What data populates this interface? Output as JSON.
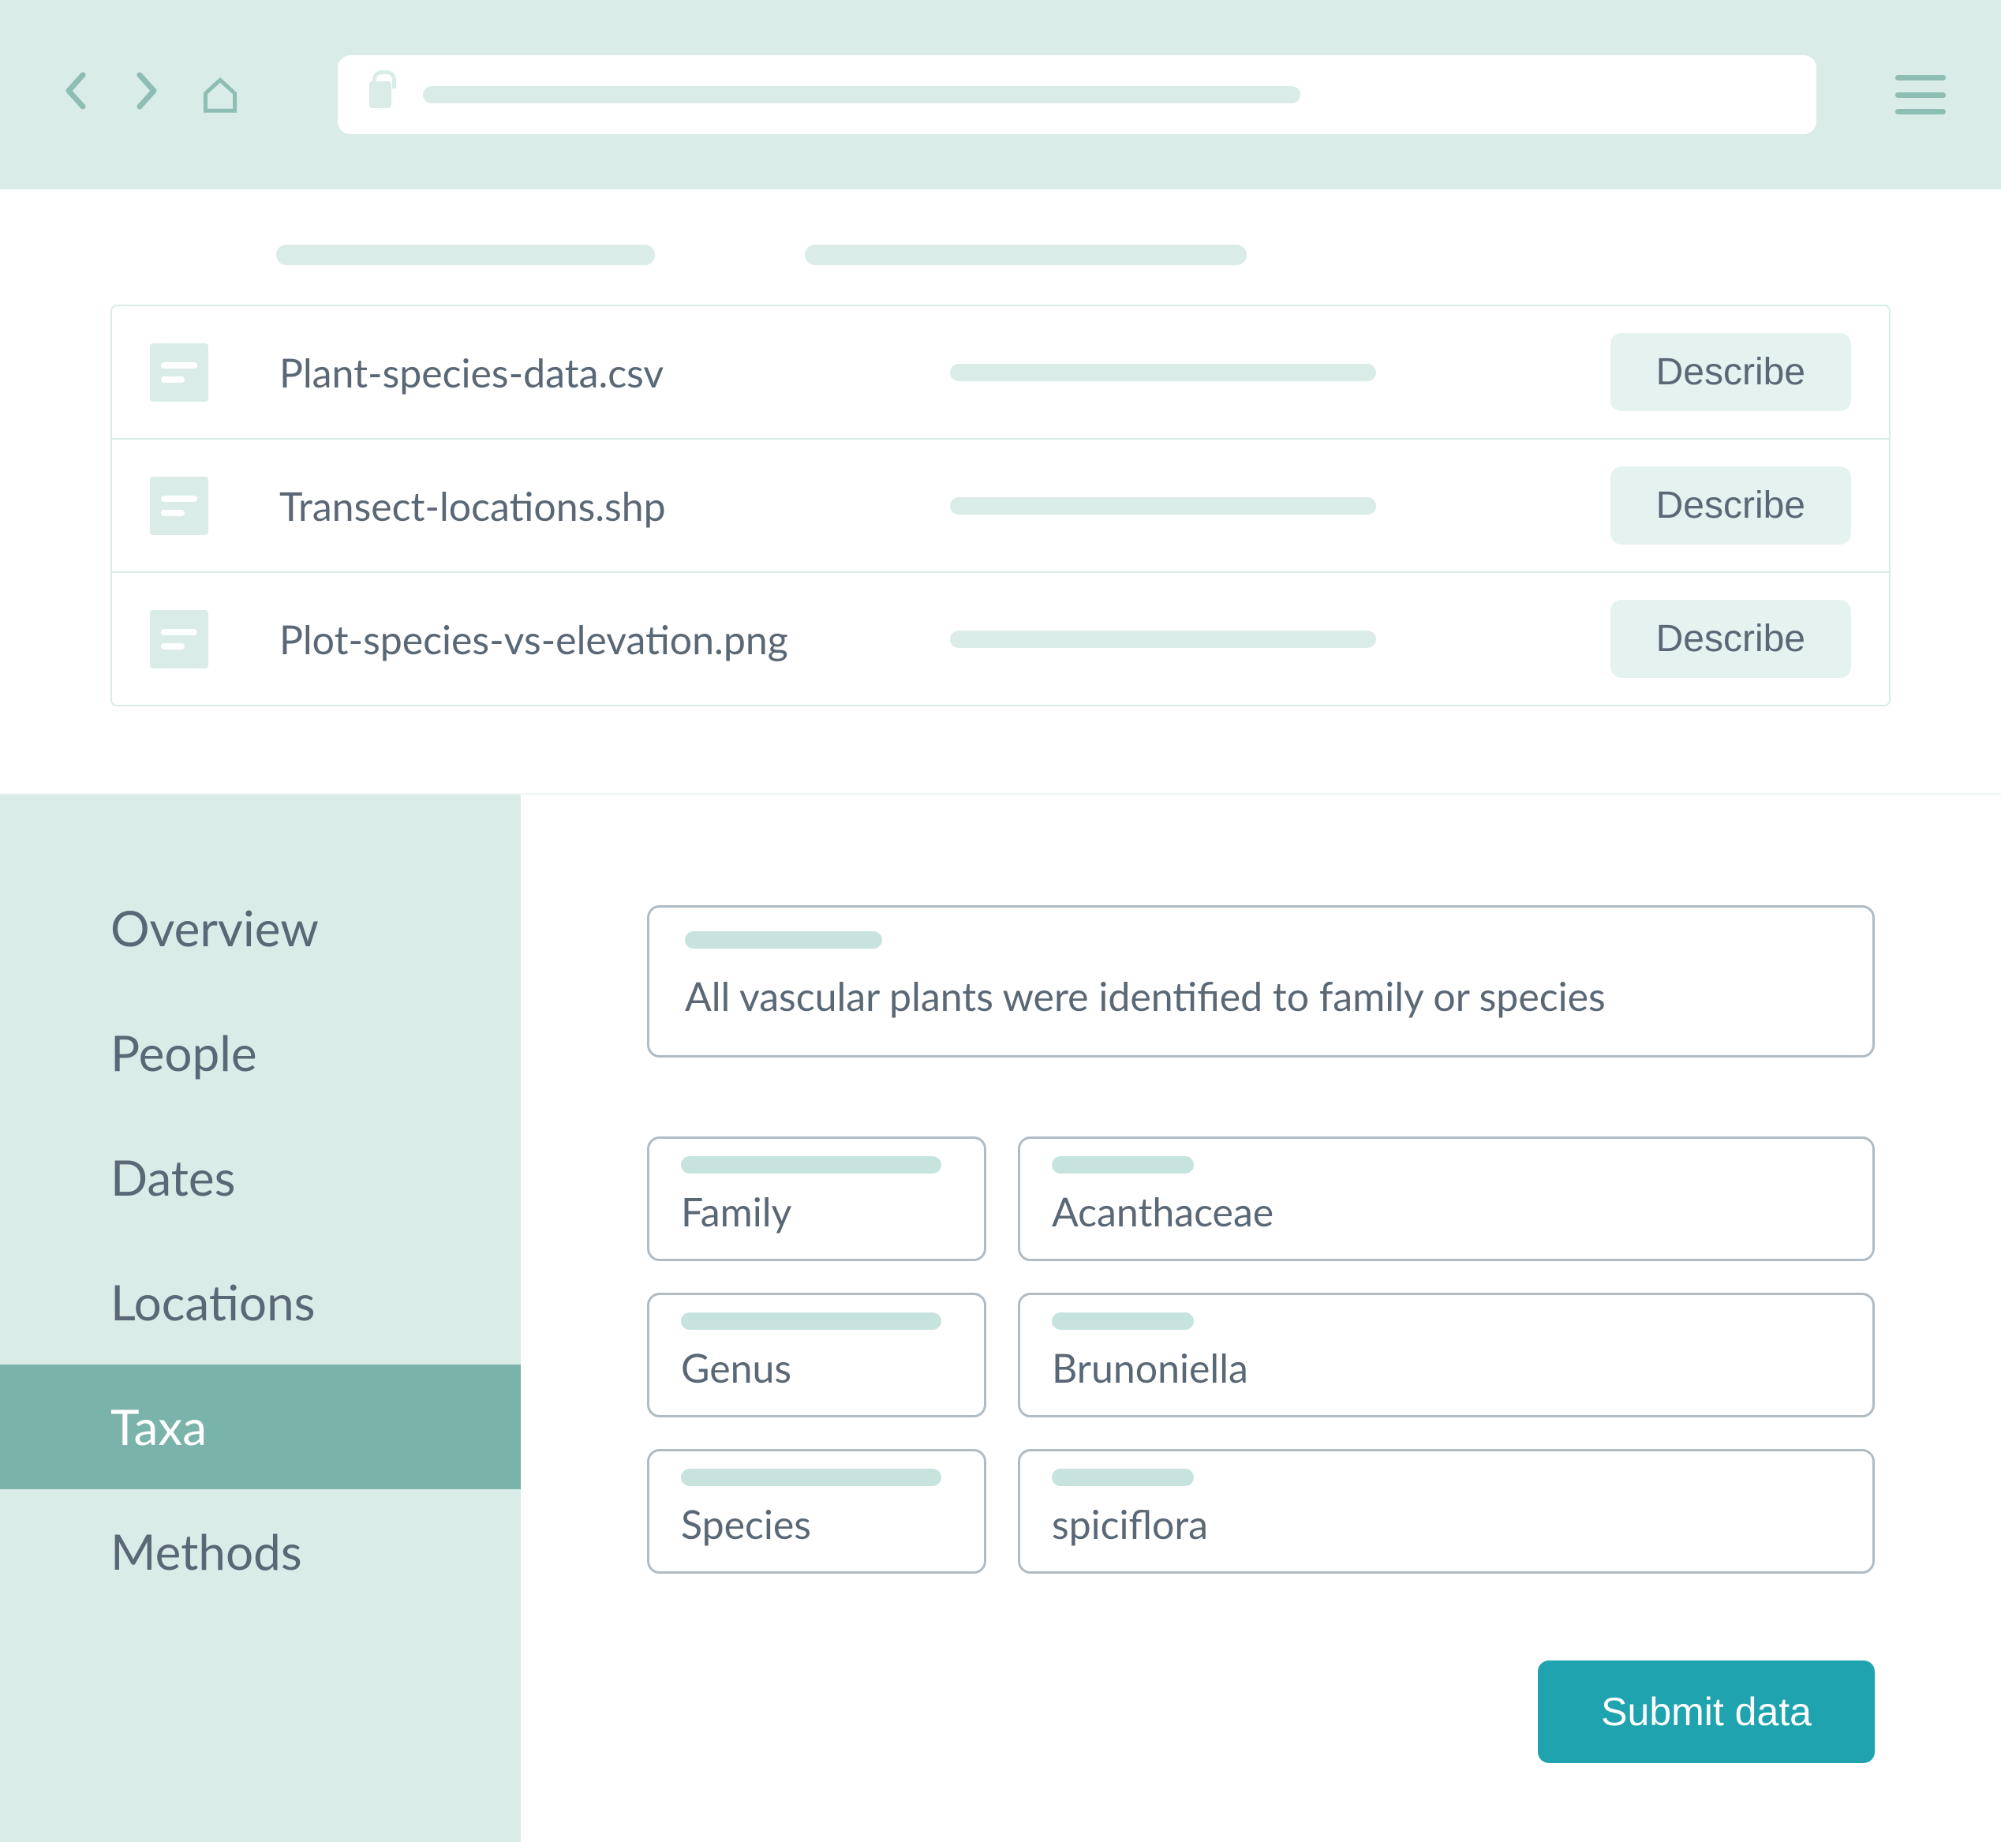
{
  "files": [
    {
      "name": "Plant-species-data.csv",
      "action": "Describe"
    },
    {
      "name": "Transect-locations.shp",
      "action": "Describe"
    },
    {
      "name": "Plot-species-vs-elevation.png",
      "action": "Describe"
    }
  ],
  "sidebar": {
    "items": [
      {
        "label": "Overview",
        "active": false
      },
      {
        "label": "People",
        "active": false
      },
      {
        "label": "Dates",
        "active": false
      },
      {
        "label": "Locations",
        "active": false
      },
      {
        "label": "Taxa",
        "active": true
      },
      {
        "label": "Methods",
        "active": false
      }
    ]
  },
  "taxa": {
    "description": "All vascular plants were identified to family or species",
    "rows": [
      {
        "rank": "Family",
        "value": "Acanthaceae"
      },
      {
        "rank": "Genus",
        "value": "Brunoniella"
      },
      {
        "rank": "Species",
        "value": "spiciflora"
      }
    ]
  },
  "buttons": {
    "submit": "Submit data"
  }
}
